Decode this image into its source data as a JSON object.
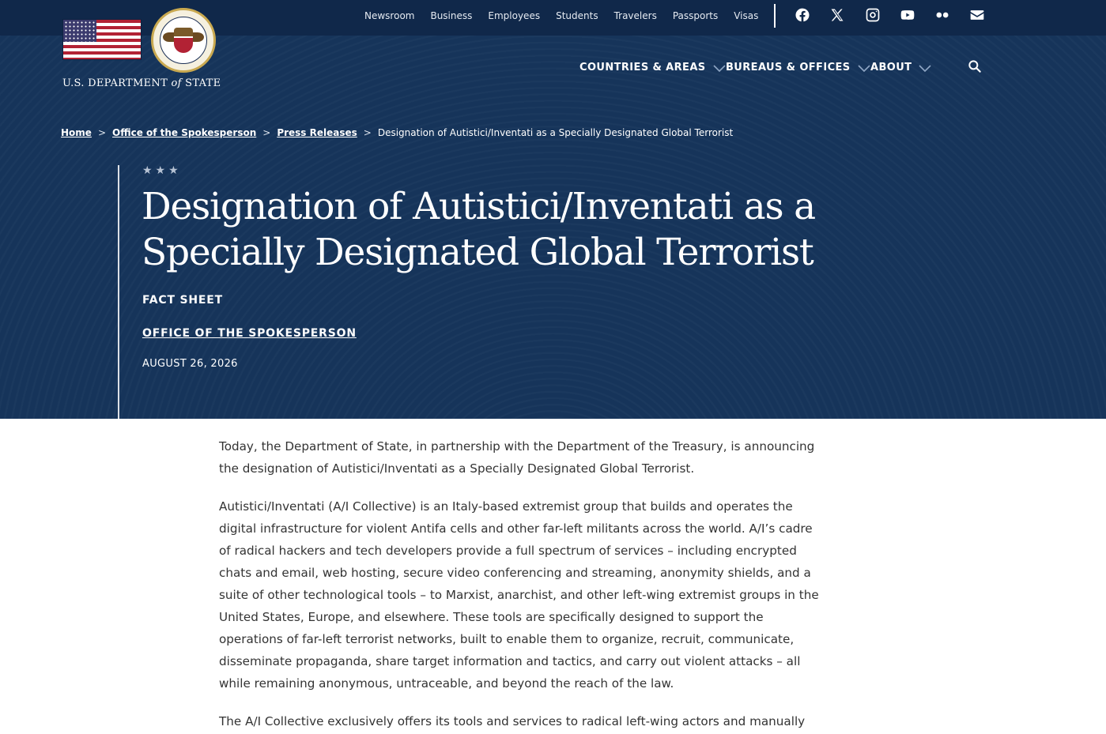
{
  "header": {
    "logo_text_prefix": "U.S. DEPARTMENT",
    "logo_text_of": "of",
    "logo_text_suffix": "STATE",
    "utility_links": [
      "Newsroom",
      "Business",
      "Employees",
      "Students",
      "Travelers",
      "Passports",
      "Visas"
    ],
    "social_icons": [
      "facebook-icon",
      "x-icon",
      "instagram-icon",
      "youtube-icon",
      "flickr-icon",
      "email-icon"
    ],
    "main_nav": [
      {
        "label": "COUNTRIES & AREAS"
      },
      {
        "label": "BUREAUS & OFFICES"
      },
      {
        "label": "ABOUT"
      }
    ],
    "search_icon": "search-icon"
  },
  "breadcrumb": {
    "items": [
      "Home",
      "Office of the Spokesperson",
      "Press Releases"
    ],
    "current": "Designation of Autisticí/Inventati as a Specially Designated Global Terrorist",
    "separator": ">"
  },
  "hero": {
    "stars": "★★★",
    "title": "Designation of Autistici/Inventati as a Specially Designated Global Terrorist",
    "doc_type": "FACT SHEET",
    "office": "OFFICE OF THE SPOKESPERSON",
    "date": "AUGUST 26, 2026"
  },
  "article": {
    "paragraphs": [
      "Today, the Department of State, in partnership with the Department of the Treasury, is announcing the designation of Autistici/Inventati as a Specially Designated Global Terrorist.",
      "Autistici/Inventati (A/I Collective) is an Italy-based extremist group that builds and operates the digital infrastructure for violent Antifa cells and other far-left militants across the world. A/I’s cadre of radical hackers and tech developers provide a full spectrum of services – including encrypted chats and email, web hosting, secure video conferencing and streaming, anonymity shields, and a suite of other technological tools – to Marxist, anarchist, and other left-wing extremist groups in the United States, Europe, and elsewhere. These tools are specifically designed to support the operations of far-left terrorist networks, built to enable them to organize, recruit, communicate, disseminate propaganda, share target information and tactics, and carry out violent attacks – all while remaining anonymous, untraceable, and beyond the reach of the law.",
      "The A/I Collective exclusively offers its tools and services to radical left-wing actors and manually vets all"
    ]
  },
  "colors": {
    "hero_bg": "#16345a",
    "topbar_bg": "#10284a",
    "text_light": "#ffffff",
    "body_text": "#333333"
  }
}
